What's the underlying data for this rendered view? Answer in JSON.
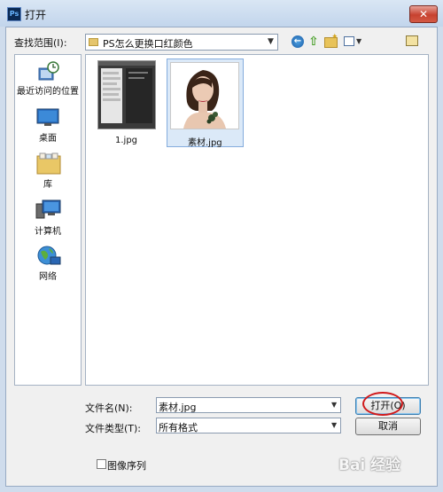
{
  "window": {
    "title": "打开",
    "app_icon": "Ps"
  },
  "look_in": {
    "label": "查找范围(I):",
    "value": "PS怎么更换口红颜色"
  },
  "places": [
    {
      "label": "最近访问的位置",
      "icon": "recent-places-icon"
    },
    {
      "label": "桌面",
      "icon": "desktop-icon"
    },
    {
      "label": "库",
      "icon": "libraries-icon"
    },
    {
      "label": "计算机",
      "icon": "computer-icon"
    },
    {
      "label": "网络",
      "icon": "network-icon"
    }
  ],
  "files": [
    {
      "name": "1.jpg",
      "selected": false
    },
    {
      "name": "素材.jpg",
      "selected": true
    }
  ],
  "file_name": {
    "label": "文件名(N):",
    "value": "素材.jpg"
  },
  "file_type": {
    "label": "文件类型(T):",
    "value": "所有格式"
  },
  "buttons": {
    "open": "打开(O)",
    "cancel": "取消"
  },
  "image_sequence": {
    "label": "图像序列",
    "checked": false
  },
  "watermark": "Bai 经验",
  "colors": {
    "highlight": "#d0191b",
    "selection": "#dbe9f8"
  }
}
